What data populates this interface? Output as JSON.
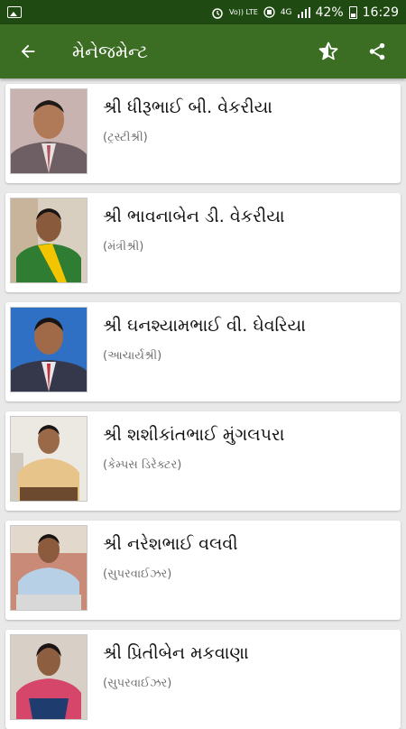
{
  "status_bar": {
    "lte_label": "Vo)) LTE",
    "network_label": "4G",
    "battery_percent": "42%",
    "time": "16:29"
  },
  "app_bar": {
    "title": "મેનેજમેન્ટ",
    "icons": [
      "arrow-back-icon",
      "star-rate-icon",
      "share-icon"
    ]
  },
  "members": [
    {
      "name": "શ્રી ધીરૂભાઈ બી. વેકરીયા",
      "role": "(ટ્રસ્ટીશ્રી)"
    },
    {
      "name": "શ્રી ભાવનાબેન ડી. વેકરીયા",
      "role": "(મંત્રીશ્રી)"
    },
    {
      "name": "શ્રી ઘનશ્યામભાઈ વી. ઘેવરિયા",
      "role": "(આચાર્યશ્રી)"
    },
    {
      "name": "શ્રી શશીકાંતભાઈ મુંગલપરા",
      "role": "(કેમ્પસ ડિરેક્ટર)"
    },
    {
      "name": "શ્રી નરેશભાઈ વલવી",
      "role": "(સુપરવાઈઝર)"
    },
    {
      "name": "શ્રી પ્રિતીબેન મકવાણા",
      "role": "(સુપરવાઈઝર)"
    }
  ],
  "colors": {
    "status_bar": "#1f4a12",
    "app_bar": "#3b6d23",
    "background": "#e9e9e9"
  }
}
